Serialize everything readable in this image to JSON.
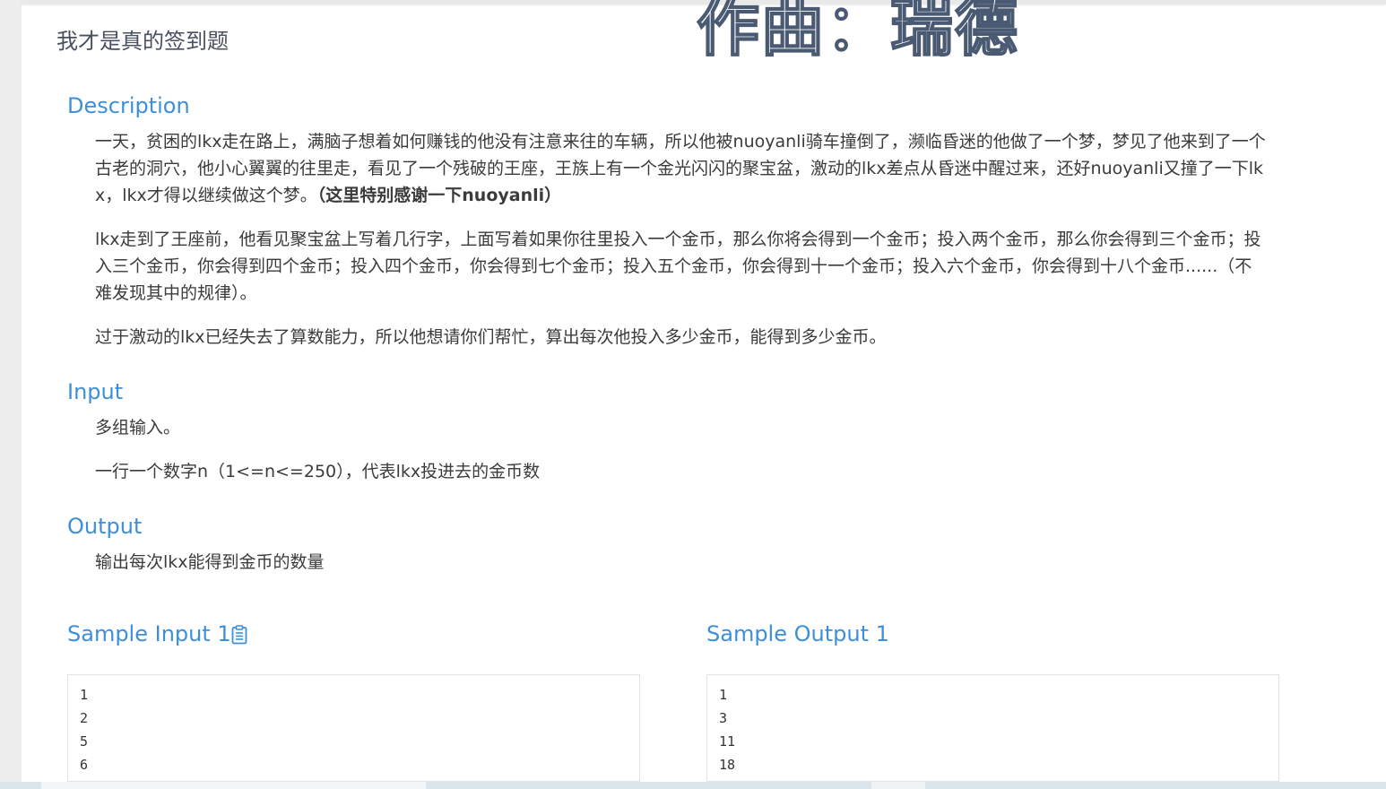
{
  "problem": {
    "title": "我才是真的签到题"
  },
  "overlay_text": "作曲：瑞德",
  "description": {
    "heading": "Description",
    "p1_lines": [
      "一天，贫困的lkx走在路上，满脑子想着如何赚钱的他没有注意来往的车辆，所以他被nuoyanli骑车撞倒了，濒临昏迷的他做了一个梦，梦见了他来到了一个",
      "古老的洞穴，他小心翼翼的往里走，看见了一个残破的王座，王族上有一个金光闪闪的聚宝盆，激动的lkx差点从昏迷中醒过来，还好nuoyanli又撞了一下lk"
    ],
    "p1_last": "x，lkx才得以继续做这个梦。",
    "p1_bold": "（这里特别感谢一下nuoyanli）",
    "p2_lines": [
      "lkx走到了王座前，他看见聚宝盆上写着几行字，上面写着如果你往里投入一个金币，那么你将会得到一个金币；投入两个金币，那么你会得到三个金币；投",
      "入三个金币，你会得到四个金币；投入四个金币，你会得到七个金币；投入五个金币，你会得到十一个金币；投入六个金币，你会得到十八个金币......（不",
      "难发现其中的规律）。"
    ],
    "p3": "过于激动的lkx已经失去了算数能力，所以他想请你们帮忙，算出每次他投入多少金币，能得到多少金币。"
  },
  "input": {
    "heading": "Input",
    "p1": "多组输入。",
    "p2": "一行一个数字n（1<=n<=250），代表lkx投进去的金币数"
  },
  "output": {
    "heading": "Output",
    "p1": "输出每次lkx能得到金币的数量"
  },
  "sample_input": {
    "heading": "Sample Input 1",
    "icon": "clipboard-icon",
    "lines": [
      "1",
      "2",
      "5",
      "6"
    ]
  },
  "sample_output": {
    "heading": "Sample Output 1",
    "lines": [
      "1",
      "3",
      "11",
      "18"
    ]
  },
  "colors": {
    "accent": "#3d8fdc",
    "title": "#495060",
    "text": "#3b3b3b"
  }
}
